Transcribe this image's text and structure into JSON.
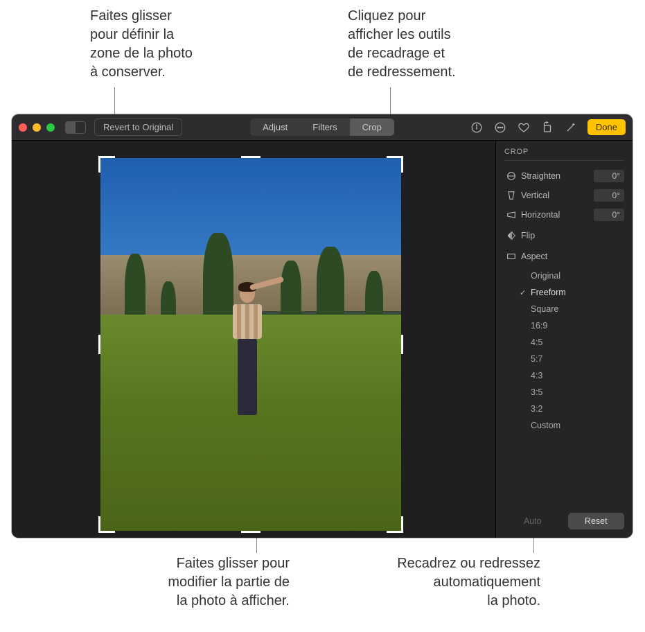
{
  "callouts": {
    "top_left": "Faites glisser\npour définir la\nzone de la photo\nà conserver.",
    "top_right": "Cliquez pour\nafficher les outils\nde recadrage et\nde redressement.",
    "bottom_left": "Faites glisser pour\nmodifier la partie de\nla photo à afficher.",
    "bottom_right": "Recadrez ou redressez\nautomatiquement\nla photo."
  },
  "toolbar": {
    "revert_label": "Revert to Original",
    "tabs": {
      "adjust": "Adjust",
      "filters": "Filters",
      "crop": "Crop"
    },
    "active_tab": "crop",
    "done_label": "Done",
    "icons": [
      "info-icon",
      "more-icon",
      "favorite-icon",
      "rotate-icon",
      "enhance-icon"
    ]
  },
  "sidebar": {
    "title": "CROP",
    "controls": {
      "straighten": {
        "label": "Straighten",
        "value": "0°"
      },
      "vertical": {
        "label": "Vertical",
        "value": "0°"
      },
      "horizontal": {
        "label": "Horizontal",
        "value": "0°"
      }
    },
    "flip_label": "Flip",
    "aspect_label": "Aspect",
    "aspect_options": [
      "Original",
      "Freeform",
      "Square",
      "16:9",
      "4:5",
      "5:7",
      "4:3",
      "3:5",
      "3:2",
      "Custom"
    ],
    "aspect_selected": "Freeform",
    "auto_label": "Auto",
    "reset_label": "Reset"
  },
  "colors": {
    "accent": "#ffc300"
  }
}
